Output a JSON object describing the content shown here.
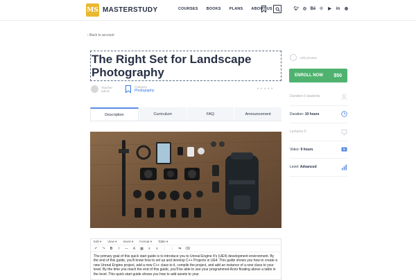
{
  "header": {
    "logo_mark": "MS",
    "logo_text": "MASTERSTUDY",
    "nav": [
      "COURSES",
      "BOOKS",
      "PLANS",
      "ABOUT US"
    ]
  },
  "back_link": "‹  Back to account",
  "course": {
    "title": "The Right Set for Landscape Photography",
    "author_label": "Teacher",
    "author_name": "admin",
    "category_label": "Category",
    "category_value": "Photography",
    "rating": "★★★★★"
  },
  "tabs": [
    "Description",
    "Curriculum",
    "FAQ",
    "Announcement"
  ],
  "editor": {
    "menu": [
      "Edit ▾",
      "View ▾",
      "Insert ▾",
      "Format ▾",
      "Table ▾"
    ],
    "toolbar": [
      "↶",
      "↷",
      "B",
      "I",
      "—",
      "A",
      "▦",
      "≡",
      "≡",
      "⋮",
      "⋮",
      "⇆",
      "⌫"
    ],
    "text": "The primary goal of this quick start guide is to introduce you to Unreal Engine 4's (UE4) development environment. By the end of this guide, you'll know how to set up and develop C++ Projects in UE4. This guide shows you how to create a new Unreal Engine project, add a new C++ class to it, compile the project, and add an instance of a new class to your level. By the time you reach the end of this guide, you'll be able to see your programmed Actor floating above a table in the level. This quick start guide shows you how to add assets to your"
  },
  "sidebar": {
    "preview_text": "Add preview",
    "enroll_label": "ENROLL NOW",
    "price": "$50",
    "items": [
      {
        "label": "Duration",
        "value": "0 students",
        "faded": true
      },
      {
        "label": "Duration:",
        "value": "10 hours",
        "faded": false
      },
      {
        "label": "Lectures",
        "value": "0",
        "faded": true
      },
      {
        "label": "Video:",
        "value": "9 hours",
        "faded": false
      },
      {
        "label": "Level:",
        "value": "Advanced",
        "faded": false
      }
    ]
  },
  "colors": {
    "accent": "#4fb36f",
    "brand": "#eab830",
    "link": "#2c75e4",
    "dark": "#273044"
  }
}
